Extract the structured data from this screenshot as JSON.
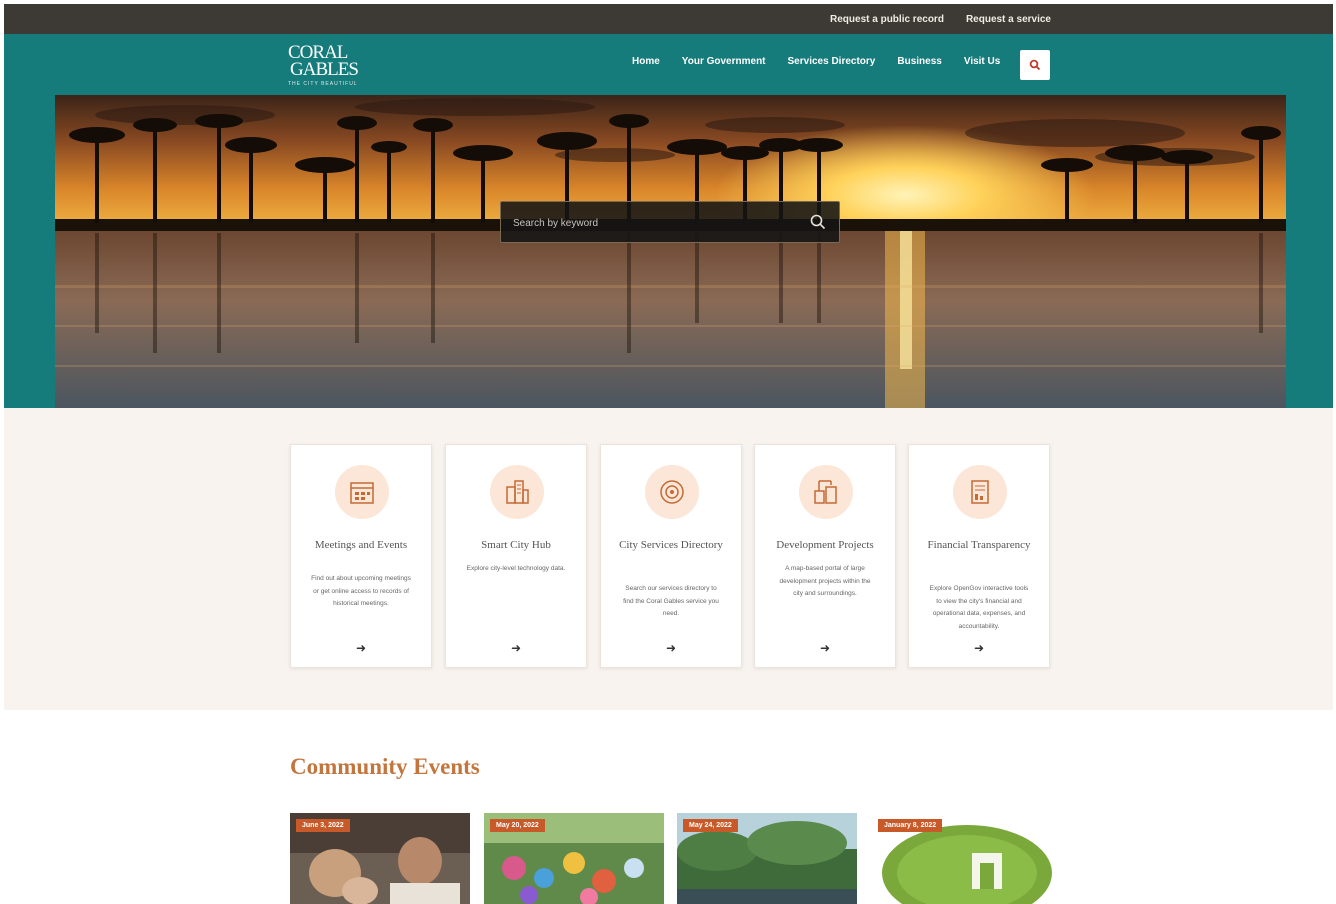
{
  "utility": {
    "links": [
      "Request a public record",
      "Request a service"
    ]
  },
  "header": {
    "logo_line1": "CORAL",
    "logo_line2": "GABLES",
    "logo_tagline": "THE CITY BEAUTIFUL",
    "nav": [
      "Home",
      "Your Government",
      "Services Directory",
      "Business",
      "Visit Us"
    ]
  },
  "hero": {
    "search_placeholder": "Search by keyword"
  },
  "quick_links": [
    {
      "title": "Meetings and Events",
      "description": "Find out about upcoming meetings or get online access to records of historical meetings."
    },
    {
      "title": "Smart City Hub",
      "description": "Explore city-level technology data."
    },
    {
      "title": "City Services Directory",
      "description": "Search our services directory to find the Coral Gables service you need."
    },
    {
      "title": "Development Projects",
      "description": "A map-based portal of large development projects within the city and surroundings."
    },
    {
      "title": "Financial Transparency",
      "description": "Explore OpenGov interactive tools to view the city's financial and operational data, expenses, and accountability."
    }
  ],
  "events": {
    "title": "Community Events",
    "items": [
      {
        "date": "June 3, 2022"
      },
      {
        "date": "May 20, 2022"
      },
      {
        "date": "May 24, 2022"
      },
      {
        "date": "January 8, 2022"
      }
    ]
  },
  "colors": {
    "teal": "#157b7b",
    "dark_bar": "#3d3a35",
    "accent": "#c3753e",
    "badge": "#c85a2a"
  }
}
